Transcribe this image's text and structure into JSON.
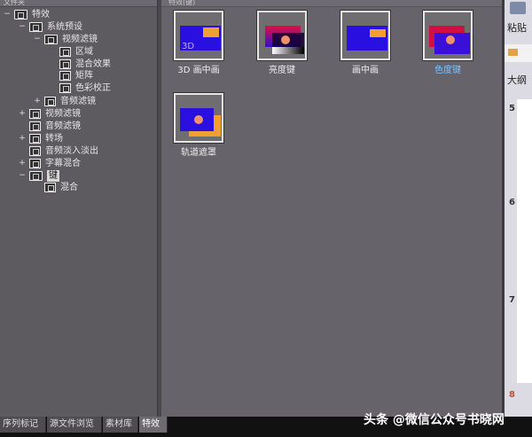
{
  "left_panel": {
    "title": "文件夹",
    "tree": [
      {
        "label": "特效",
        "expander": "−"
      },
      {
        "label": "系统预设",
        "expander": "−"
      },
      {
        "label": "视频滤镜",
        "expander": "−"
      },
      {
        "label": "区域",
        "expander": ""
      },
      {
        "label": "混合效果",
        "expander": ""
      },
      {
        "label": "矩阵",
        "expander": ""
      },
      {
        "label": "色彩校正",
        "expander": ""
      },
      {
        "label": "音频滤镜",
        "expander": "+"
      },
      {
        "label": "视频滤镜",
        "expander": "+"
      },
      {
        "label": "音频滤镜",
        "expander": ""
      },
      {
        "label": "转场",
        "expander": "+"
      },
      {
        "label": "音频淡入淡出",
        "expander": ""
      },
      {
        "label": "字幕混合",
        "expander": "+"
      },
      {
        "label": "键",
        "expander": "−"
      },
      {
        "label": "混合",
        "expander": ""
      }
    ]
  },
  "main_panel": {
    "title": "特效(键)",
    "items": [
      {
        "label": "3D 画中画",
        "thumb_text": "3D"
      },
      {
        "label": "亮度键"
      },
      {
        "label": "画中画"
      },
      {
        "label": "色度键"
      },
      {
        "label": "轨道遮罩"
      }
    ]
  },
  "right_strip": {
    "paste": "粘贴",
    "outline": "大纲",
    "rows": [
      "5",
      "6",
      "7",
      "8"
    ]
  },
  "bottom_tabs": [
    "序列标记",
    "源文件浏览",
    "素材库",
    "特效"
  ],
  "watermark": "头条 @微信公众号书晓网"
}
